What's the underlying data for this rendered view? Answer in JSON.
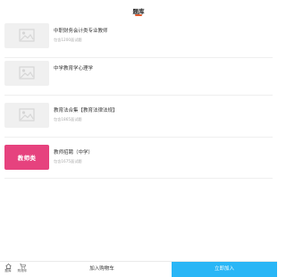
{
  "header": {
    "title": "题库"
  },
  "items": [
    {
      "title": "中职财务会计类专业教师",
      "subtitle": "包含1200面试题",
      "thumb": "image-placeholder"
    },
    {
      "title": "中学教育学心理学",
      "subtitle": "",
      "thumb": "image-placeholder"
    },
    {
      "title": "教育法合集【教育法律法规】",
      "subtitle": "包含1865面试题",
      "thumb": "image-placeholder"
    },
    {
      "title": "教师招聘（中学）",
      "subtitle": "包含1675面试题",
      "thumb_label": "教师类",
      "thumb_color": "#e6427e"
    }
  ],
  "bottom": {
    "home_label": "题库",
    "cart_label": "购物车",
    "add_to_cart": "加入购物车",
    "buy_now": "立即加入",
    "buy_color": "#29b6f6"
  }
}
